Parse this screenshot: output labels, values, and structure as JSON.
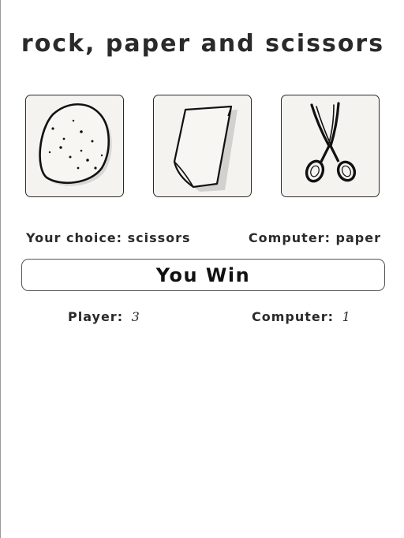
{
  "title": "rock, paper and scissors",
  "choices": [
    {
      "id": "rock",
      "icon": "rock-icon"
    },
    {
      "id": "paper",
      "icon": "paper-icon"
    },
    {
      "id": "scissors",
      "icon": "scissors-icon"
    }
  ],
  "status": {
    "your_choice_label": "Your choice:",
    "your_choice_value": "scissors",
    "computer_label": "Computer:",
    "computer_value": "paper"
  },
  "result": "You Win",
  "score": {
    "player_label": "Player:",
    "player_value": "3",
    "computer_label": "Computer:",
    "computer_value": "1"
  },
  "colors": {
    "card_bg": "#f4f3f0",
    "border": "#2b2b2b",
    "text": "#2a2a2a"
  }
}
